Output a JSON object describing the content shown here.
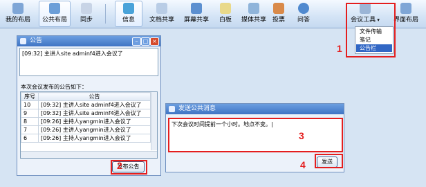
{
  "toolbar": {
    "my_layout": "我的布局",
    "public_layout": "公共布局",
    "sync": "同步",
    "info": "信息",
    "file_share": "文档共享",
    "screen_share": "屏幕共享",
    "whiteboard": "白板",
    "media_share": "媒体共享",
    "vote": "投票",
    "qa": "问答",
    "meeting_tools": "会议工具",
    "interface_layout": "界面布局"
  },
  "dropdown": {
    "items": [
      "文件传输",
      "笔记",
      "公告栏"
    ],
    "selected": "公告栏"
  },
  "notice_window": {
    "title": "公告",
    "current_notice": "[09:32] 主讲人site adminf4进入会议了",
    "history_label": "本次会议发布的公告如下：",
    "columns": [
      "序号",
      "公告"
    ],
    "rows": [
      {
        "no": "10",
        "text": "[09:32] 主讲人site adminf4进入会议了"
      },
      {
        "no": "9",
        "text": "[09:32] 主讲人site adminf4进入会议了"
      },
      {
        "no": "8",
        "text": "[09:26] 主持人yangmin进入会议了"
      },
      {
        "no": "7",
        "text": "[09:26] 主讲人yangmin进入会议了"
      },
      {
        "no": "6",
        "text": "[09:26] 主持人yangmin进入会议了"
      }
    ],
    "publish_button": "发布公告"
  },
  "send_window": {
    "title": "发送公共消息",
    "message": "下次会议时间提前一个小时。地点不变。|",
    "send_button": "发送"
  },
  "annotations": [
    "1",
    "2",
    "3",
    "4"
  ],
  "colors": {
    "highlight": "#e41e1e",
    "title_bar": "#3f74c4",
    "selection": "#3167c5"
  }
}
